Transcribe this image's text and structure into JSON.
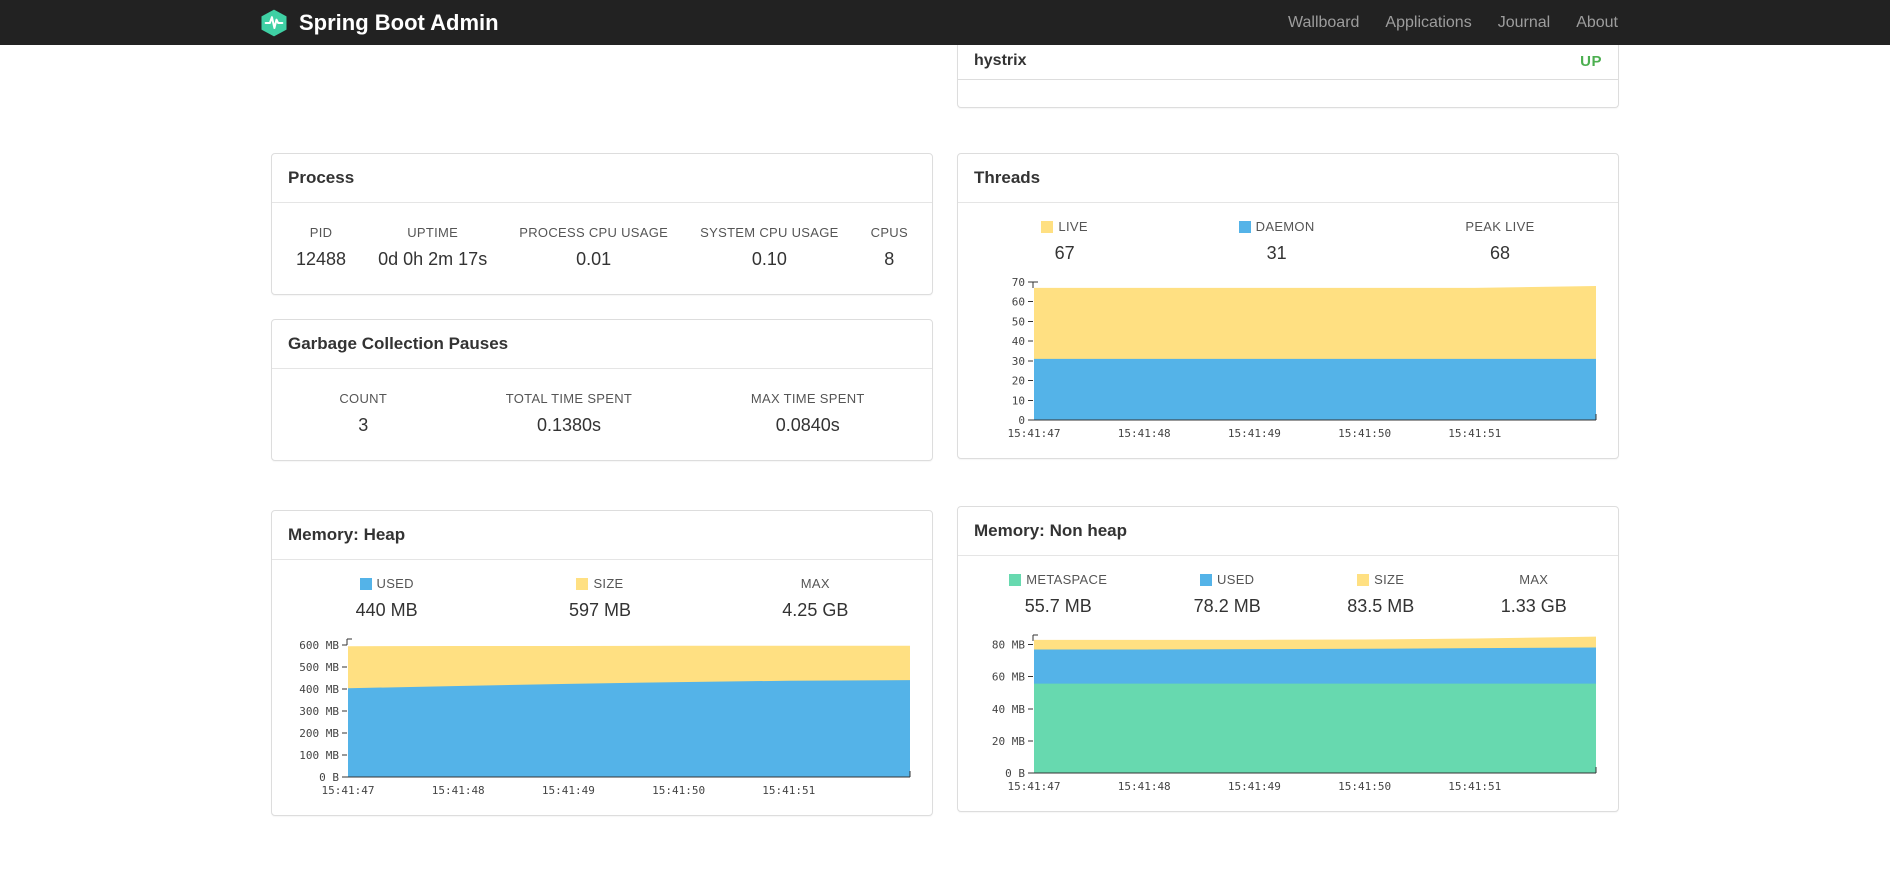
{
  "navbar": {
    "brand": "Spring Boot Admin",
    "links": [
      {
        "label": "Wallboard"
      },
      {
        "label": "Applications"
      },
      {
        "label": "Journal"
      },
      {
        "label": "About"
      }
    ]
  },
  "colors": {
    "navbar_bg": "#222222",
    "accent": "#3fd0a4",
    "up": "#4caf50",
    "blue": "#54b3e8",
    "yellow": "#ffe082",
    "green": "#67d9af"
  },
  "applications_panel": {
    "app_name": "hystrix",
    "status": "UP"
  },
  "process": {
    "title": "Process",
    "metrics": [
      {
        "label": "PID",
        "value": "12488"
      },
      {
        "label": "UPTIME",
        "value": "0d 0h 2m 17s"
      },
      {
        "label": "PROCESS CPU USAGE",
        "value": "0.01"
      },
      {
        "label": "SYSTEM CPU USAGE",
        "value": "0.10"
      },
      {
        "label": "CPUS",
        "value": "8"
      }
    ]
  },
  "gc": {
    "title": "Garbage Collection Pauses",
    "metrics": [
      {
        "label": "COUNT",
        "value": "3"
      },
      {
        "label": "TOTAL TIME SPENT",
        "value": "0.1380s"
      },
      {
        "label": "MAX TIME SPENT",
        "value": "0.0840s"
      }
    ]
  },
  "threads": {
    "title": "Threads",
    "legend": [
      {
        "label": "LIVE",
        "value": "67",
        "swatch": "#ffe082"
      },
      {
        "label": "DAEMON",
        "value": "31",
        "swatch": "#54b3e8"
      },
      {
        "label": "PEAK LIVE",
        "value": "68"
      }
    ]
  },
  "heap": {
    "title": "Memory: Heap",
    "legend": [
      {
        "label": "USED",
        "value": "440 MB",
        "swatch": "#54b3e8"
      },
      {
        "label": "SIZE",
        "value": "597 MB",
        "swatch": "#ffe082"
      },
      {
        "label": "MAX",
        "value": "4.25 GB"
      }
    ]
  },
  "nonheap": {
    "title": "Memory: Non heap",
    "legend": [
      {
        "label": "METASPACE",
        "value": "55.7 MB",
        "swatch": "#67d9af"
      },
      {
        "label": "USED",
        "value": "78.2 MB",
        "swatch": "#54b3e8"
      },
      {
        "label": "SIZE",
        "value": "83.5 MB",
        "swatch": "#ffe082"
      },
      {
        "label": "MAX",
        "value": "1.33 GB"
      }
    ]
  },
  "chart_data": [
    {
      "id": "threads",
      "type": "area",
      "title": "Threads",
      "stack_mode": "cumulative-tops",
      "grid": false,
      "legend_position": "top",
      "x": [
        0,
        1,
        2,
        3,
        4,
        5.1
      ],
      "xtick_pos": [
        0,
        1,
        2,
        3,
        4
      ],
      "xtick_labels": [
        "15:41:47",
        "15:41:48",
        "15:41:49",
        "15:41:50",
        "15:41:51"
      ],
      "ylim": [
        0,
        70
      ],
      "yticks": [
        {
          "v": 70,
          "label": "70"
        },
        {
          "v": 60,
          "label": "60"
        },
        {
          "v": 50,
          "label": "50"
        },
        {
          "v": 40,
          "label": "40"
        },
        {
          "v": 30,
          "label": "30"
        },
        {
          "v": 20,
          "label": "20"
        },
        {
          "v": 10,
          "label": "10"
        },
        {
          "v": 0,
          "label": "0"
        }
      ],
      "series": [
        {
          "name": "DAEMON",
          "color": "#54b3e8",
          "tops": [
            31,
            31,
            31,
            31,
            31,
            31
          ]
        },
        {
          "name": "LIVE",
          "color": "#ffe082",
          "tops": [
            67,
            67,
            67,
            67,
            67,
            68
          ]
        }
      ]
    },
    {
      "id": "memory-heap",
      "type": "area",
      "title": "Memory: Heap",
      "stack_mode": "cumulative-tops",
      "grid": false,
      "legend_position": "top",
      "x": [
        0,
        1,
        2,
        3,
        4,
        5.1
      ],
      "xtick_pos": [
        0,
        1,
        2,
        3,
        4
      ],
      "xtick_labels": [
        "15:41:47",
        "15:41:48",
        "15:41:49",
        "15:41:50",
        "15:41:51"
      ],
      "ylim": [
        0,
        628
      ],
      "yticks": [
        {
          "v": 600,
          "label": "600 MB"
        },
        {
          "v": 500,
          "label": "500 MB"
        },
        {
          "v": 400,
          "label": "400 MB"
        },
        {
          "v": 300,
          "label": "300 MB"
        },
        {
          "v": 200,
          "label": "200 MB"
        },
        {
          "v": 100,
          "label": "100 MB"
        },
        {
          "v": 0,
          "label": "0 B"
        }
      ],
      "series": [
        {
          "name": "USED",
          "color": "#54b3e8",
          "tops": [
            404,
            414,
            424,
            432,
            438,
            441
          ]
        },
        {
          "name": "SIZE",
          "color": "#ffe082",
          "tops": [
            595,
            596,
            596,
            597,
            597,
            597
          ]
        }
      ]
    },
    {
      "id": "memory-non-heap",
      "type": "area",
      "title": "Memory: Non heap",
      "stack_mode": "cumulative-tops",
      "grid": false,
      "legend_position": "top",
      "x": [
        0,
        1,
        2,
        3,
        4,
        5.1
      ],
      "xtick_pos": [
        0,
        1,
        2,
        3,
        4
      ],
      "xtick_labels": [
        "15:41:47",
        "15:41:48",
        "15:41:49",
        "15:41:50",
        "15:41:51"
      ],
      "ylim": [
        0,
        86
      ],
      "yticks": [
        {
          "v": 80,
          "label": "80 MB"
        },
        {
          "v": 60,
          "label": "60 MB"
        },
        {
          "v": 40,
          "label": "40 MB"
        },
        {
          "v": 20,
          "label": "20 MB"
        },
        {
          "v": 0,
          "label": "0 B"
        }
      ],
      "series": [
        {
          "name": "METASPACE",
          "color": "#67d9af",
          "tops": [
            55.7,
            55.7,
            55.7,
            55.7,
            55.7,
            55.7
          ]
        },
        {
          "name": "USED",
          "color": "#54b3e8",
          "tops": [
            77,
            77,
            77.2,
            77.4,
            77.8,
            78.2
          ]
        },
        {
          "name": "SIZE",
          "color": "#ffe082",
          "tops": [
            83,
            83,
            83,
            83.2,
            83.8,
            85
          ]
        }
      ]
    }
  ]
}
